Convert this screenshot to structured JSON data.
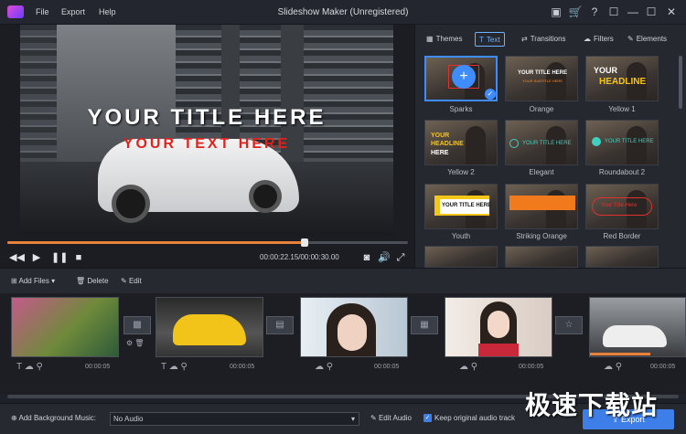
{
  "app": {
    "menu": [
      "File",
      "Export",
      "Help"
    ],
    "title": "Slideshow Maker (Unregistered)"
  },
  "preview": {
    "overlay_title": "YOUR TITLE HERE",
    "overlay_text": "YOUR TEXT HERE",
    "timecode": "00:00:22.15/00:00:30.00",
    "progress": 0.743
  },
  "tabs": [
    {
      "label": "Themes",
      "icon": "grid-icon"
    },
    {
      "label": "Text",
      "icon": "text-icon",
      "active": true
    },
    {
      "label": "Transitions",
      "icon": "transitions-icon"
    },
    {
      "label": "Filters",
      "icon": "filters-icon"
    },
    {
      "label": "Elements",
      "icon": "elements-icon"
    }
  ],
  "text_presets": [
    {
      "name": "Sparks",
      "line1": "",
      "line2": "",
      "selected": true
    },
    {
      "name": "Orange",
      "line1": "YOUR TITLE HERE",
      "line2": "YOUR SUBTITLE HERE"
    },
    {
      "name": "Yellow 1",
      "line1": "YOUR",
      "line2": "HEADLINE"
    },
    {
      "name": "Yellow 2",
      "line1": "YOUR HEADLINE",
      "line2": "HERE"
    },
    {
      "name": "Elegant",
      "line1": "YOUR TITLE HERE",
      "line2": ""
    },
    {
      "name": "Roundabout 2",
      "line1": "YOUR TITLE HERE",
      "line2": ""
    },
    {
      "name": "Youth",
      "line1": "YOUR TITLE HERE",
      "line2": ""
    },
    {
      "name": "Striking Orange",
      "line1": "",
      "line2": ""
    },
    {
      "name": "Red Border",
      "line1": "Your Title Here",
      "line2": ""
    }
  ],
  "timeline_toolbar": {
    "add_files": "Add Files",
    "delete": "Delete",
    "edit": "Edit"
  },
  "clips": [
    {
      "name": "forest",
      "duration": "00:00:05"
    },
    {
      "name": "yellow-car",
      "duration": "00:00:05"
    },
    {
      "name": "woman-portrait-1",
      "duration": "00:00:05"
    },
    {
      "name": "woman-portrait-2",
      "duration": "00:00:05"
    },
    {
      "name": "white-car",
      "duration": "00:00:05"
    }
  ],
  "footer": {
    "add_music": "Add Background Music:",
    "audio_value": "No Audio",
    "edit_audio": "Edit Audio",
    "keep_original": "Keep original audio track",
    "export": "Export"
  },
  "watermark": "极速下载站",
  "colors": {
    "accent": "#3d7ee8",
    "progress": "#e8823a",
    "title_white": "#ffffff",
    "text_red": "#e0221c"
  }
}
